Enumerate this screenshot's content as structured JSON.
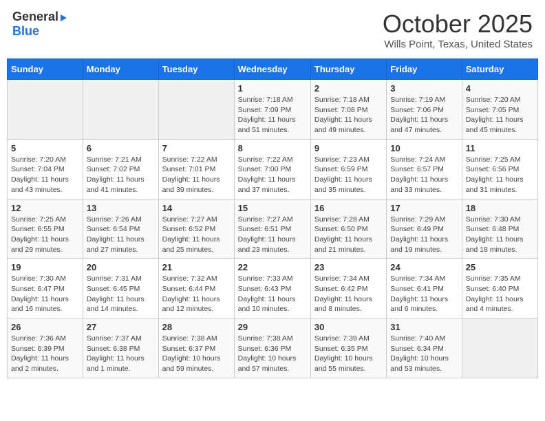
{
  "header": {
    "logo_general": "General",
    "logo_blue": "Blue",
    "title": "October 2025",
    "location": "Wills Point, Texas, United States"
  },
  "calendar": {
    "weekdays": [
      "Sunday",
      "Monday",
      "Tuesday",
      "Wednesday",
      "Thursday",
      "Friday",
      "Saturday"
    ],
    "weeks": [
      {
        "days": [
          {
            "num": "",
            "info": ""
          },
          {
            "num": "",
            "info": ""
          },
          {
            "num": "",
            "info": ""
          },
          {
            "num": "1",
            "info": "Sunrise: 7:18 AM\nSunset: 7:09 PM\nDaylight: 11 hours\nand 51 minutes."
          },
          {
            "num": "2",
            "info": "Sunrise: 7:18 AM\nSunset: 7:08 PM\nDaylight: 11 hours\nand 49 minutes."
          },
          {
            "num": "3",
            "info": "Sunrise: 7:19 AM\nSunset: 7:06 PM\nDaylight: 11 hours\nand 47 minutes."
          },
          {
            "num": "4",
            "info": "Sunrise: 7:20 AM\nSunset: 7:05 PM\nDaylight: 11 hours\nand 45 minutes."
          }
        ]
      },
      {
        "days": [
          {
            "num": "5",
            "info": "Sunrise: 7:20 AM\nSunset: 7:04 PM\nDaylight: 11 hours\nand 43 minutes."
          },
          {
            "num": "6",
            "info": "Sunrise: 7:21 AM\nSunset: 7:02 PM\nDaylight: 11 hours\nand 41 minutes."
          },
          {
            "num": "7",
            "info": "Sunrise: 7:22 AM\nSunset: 7:01 PM\nDaylight: 11 hours\nand 39 minutes."
          },
          {
            "num": "8",
            "info": "Sunrise: 7:22 AM\nSunset: 7:00 PM\nDaylight: 11 hours\nand 37 minutes."
          },
          {
            "num": "9",
            "info": "Sunrise: 7:23 AM\nSunset: 6:59 PM\nDaylight: 11 hours\nand 35 minutes."
          },
          {
            "num": "10",
            "info": "Sunrise: 7:24 AM\nSunset: 6:57 PM\nDaylight: 11 hours\nand 33 minutes."
          },
          {
            "num": "11",
            "info": "Sunrise: 7:25 AM\nSunset: 6:56 PM\nDaylight: 11 hours\nand 31 minutes."
          }
        ]
      },
      {
        "days": [
          {
            "num": "12",
            "info": "Sunrise: 7:25 AM\nSunset: 6:55 PM\nDaylight: 11 hours\nand 29 minutes."
          },
          {
            "num": "13",
            "info": "Sunrise: 7:26 AM\nSunset: 6:54 PM\nDaylight: 11 hours\nand 27 minutes."
          },
          {
            "num": "14",
            "info": "Sunrise: 7:27 AM\nSunset: 6:52 PM\nDaylight: 11 hours\nand 25 minutes."
          },
          {
            "num": "15",
            "info": "Sunrise: 7:27 AM\nSunset: 6:51 PM\nDaylight: 11 hours\nand 23 minutes."
          },
          {
            "num": "16",
            "info": "Sunrise: 7:28 AM\nSunset: 6:50 PM\nDaylight: 11 hours\nand 21 minutes."
          },
          {
            "num": "17",
            "info": "Sunrise: 7:29 AM\nSunset: 6:49 PM\nDaylight: 11 hours\nand 19 minutes."
          },
          {
            "num": "18",
            "info": "Sunrise: 7:30 AM\nSunset: 6:48 PM\nDaylight: 11 hours\nand 18 minutes."
          }
        ]
      },
      {
        "days": [
          {
            "num": "19",
            "info": "Sunrise: 7:30 AM\nSunset: 6:47 PM\nDaylight: 11 hours\nand 16 minutes."
          },
          {
            "num": "20",
            "info": "Sunrise: 7:31 AM\nSunset: 6:45 PM\nDaylight: 11 hours\nand 14 minutes."
          },
          {
            "num": "21",
            "info": "Sunrise: 7:32 AM\nSunset: 6:44 PM\nDaylight: 11 hours\nand 12 minutes."
          },
          {
            "num": "22",
            "info": "Sunrise: 7:33 AM\nSunset: 6:43 PM\nDaylight: 11 hours\nand 10 minutes."
          },
          {
            "num": "23",
            "info": "Sunrise: 7:34 AM\nSunset: 6:42 PM\nDaylight: 11 hours\nand 8 minutes."
          },
          {
            "num": "24",
            "info": "Sunrise: 7:34 AM\nSunset: 6:41 PM\nDaylight: 11 hours\nand 6 minutes."
          },
          {
            "num": "25",
            "info": "Sunrise: 7:35 AM\nSunset: 6:40 PM\nDaylight: 11 hours\nand 4 minutes."
          }
        ]
      },
      {
        "days": [
          {
            "num": "26",
            "info": "Sunrise: 7:36 AM\nSunset: 6:39 PM\nDaylight: 11 hours\nand 2 minutes."
          },
          {
            "num": "27",
            "info": "Sunrise: 7:37 AM\nSunset: 6:38 PM\nDaylight: 11 hours\nand 1 minute."
          },
          {
            "num": "28",
            "info": "Sunrise: 7:38 AM\nSunset: 6:37 PM\nDaylight: 10 hours\nand 59 minutes."
          },
          {
            "num": "29",
            "info": "Sunrise: 7:38 AM\nSunset: 6:36 PM\nDaylight: 10 hours\nand 57 minutes."
          },
          {
            "num": "30",
            "info": "Sunrise: 7:39 AM\nSunset: 6:35 PM\nDaylight: 10 hours\nand 55 minutes."
          },
          {
            "num": "31",
            "info": "Sunrise: 7:40 AM\nSunset: 6:34 PM\nDaylight: 10 hours\nand 53 minutes."
          },
          {
            "num": "",
            "info": ""
          }
        ]
      }
    ]
  }
}
